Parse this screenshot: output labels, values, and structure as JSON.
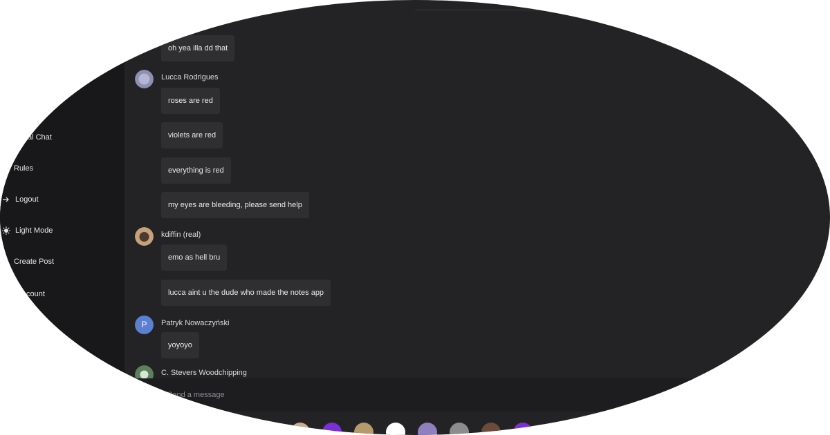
{
  "sidebar": {
    "items": [
      {
        "label": "al Chat"
      },
      {
        "label": "Rules"
      },
      {
        "label": "Logout"
      },
      {
        "label": "Light Mode"
      },
      {
        "label": "Create Post"
      },
      {
        "label": "count"
      }
    ]
  },
  "chat": {
    "groups": [
      {
        "author": null,
        "messages": [
          "oh yea illa dd that"
        ]
      },
      {
        "author": "Lucca Rodrigues",
        "messages": [
          "roses are red",
          "violets are red",
          "everything is red",
          "my eyes are bleeding, please send help"
        ]
      },
      {
        "author": "kdiffin (real)",
        "messages": [
          "emo as hell bru",
          "lucca aint u the dude who made the notes app"
        ]
      },
      {
        "author": "Patryk Nowaczyński",
        "avatar_letter": "P",
        "messages": [
          "yoyoyo"
        ]
      },
      {
        "author": "C. Stevers Woodchipping",
        "messages": []
      }
    ]
  },
  "composer": {
    "placeholder": "Send a message"
  },
  "colors": {
    "background": "#232325",
    "sidebar": "#18181a",
    "bubble": "#2f2f31",
    "accent": "#5b7fd1"
  }
}
